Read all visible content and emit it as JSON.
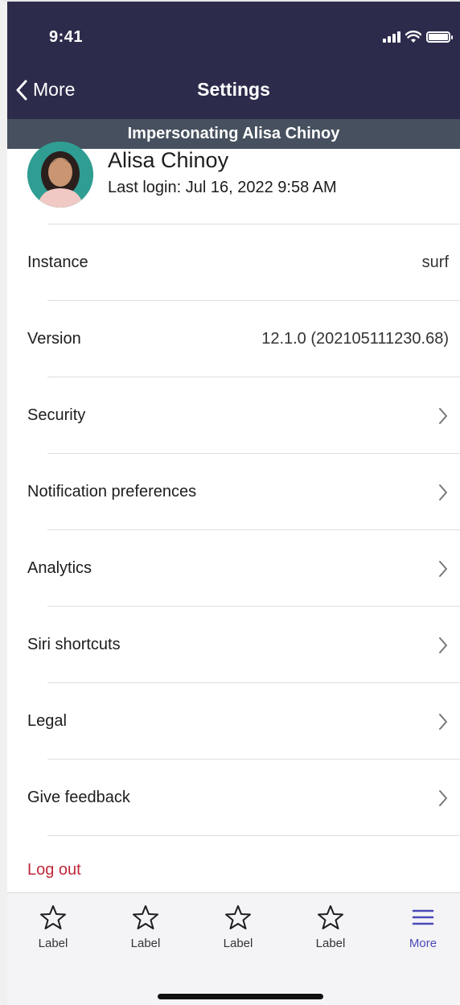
{
  "status_bar": {
    "time": "9:41"
  },
  "nav": {
    "back_label": "More",
    "title": "Settings"
  },
  "banner": {
    "text": "Impersonating Alisa Chinoy"
  },
  "profile": {
    "name": "Alisa Chinoy",
    "last_login": "Last login: Jul 16, 2022 9:58 AM"
  },
  "rows": [
    {
      "label": "Instance",
      "value": "surf"
    },
    {
      "label": "Version",
      "value": "12.1.0 (202105111230.68)"
    },
    {
      "label": "Security"
    },
    {
      "label": "Notification preferences"
    },
    {
      "label": "Analytics"
    },
    {
      "label": "Siri shortcuts"
    },
    {
      "label": "Legal"
    },
    {
      "label": "Give feedback"
    }
  ],
  "logout": {
    "label": "Log out"
  },
  "tabbar": {
    "tabs": [
      {
        "label": "Label",
        "icon": "star-icon"
      },
      {
        "label": "Label",
        "icon": "star-icon"
      },
      {
        "label": "Label",
        "icon": "star-icon"
      },
      {
        "label": "Label",
        "icon": "star-icon"
      },
      {
        "label": "More",
        "icon": "menu-icon",
        "active": true
      }
    ]
  },
  "colors": {
    "header_bg": "#2c2b4b",
    "banner_bg": "#46505e",
    "logout": "#c0283a",
    "active_tab": "#4a4ab8"
  }
}
